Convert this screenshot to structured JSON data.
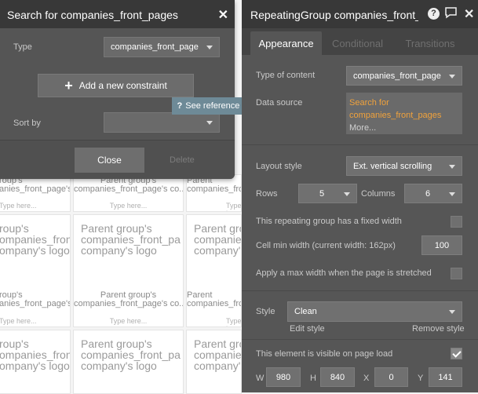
{
  "background": {
    "name_text": "Parent group's\ncompanies_front_page's co...",
    "logo_text": "Parent group's\ncompanies_front_pa\ncompany's logo",
    "type_here": "Type here...",
    "partial_logo": "roup's\nompanies_front_pa\nompany's logo",
    "partial_name_left": "roup's\nanies_front_page's co...",
    "partial_name_right": "Parent\ncompanies_front"
  },
  "left_panel": {
    "title": "Search for companies_front_pages",
    "close_icon": "close-icon",
    "type_label": "Type",
    "type_value": "companies_front_page",
    "add_constraint_label": "Add a new constraint",
    "sort_by_label": "Sort by",
    "sort_by_value": "",
    "close_button": "Close",
    "delete_button": "Delete"
  },
  "see_reference": {
    "label": "See reference →",
    "icon": "question-icon"
  },
  "right_panel": {
    "title": "RepeatingGroup companies_front_pa",
    "icons": [
      "help-icon",
      "comment-icon",
      "close-icon"
    ],
    "tabs": [
      "Appearance",
      "Conditional",
      "Transitions"
    ],
    "active_tab": "Appearance",
    "type_of_content_label": "Type of content",
    "type_of_content_value": "companies_front_page",
    "data_source_label": "Data source",
    "data_source_line1": "Search for",
    "data_source_line2": "companies_front_pages",
    "data_source_more": "More...",
    "layout_style_label": "Layout style",
    "layout_style_value": "Ext. vertical scrolling",
    "rows_label": "Rows",
    "rows_value": "5",
    "columns_label": "Columns",
    "columns_value": "6",
    "fixed_width_label": "This repeating group has a fixed width",
    "fixed_width_checked": false,
    "cell_min_width_label": "Cell min width (current width: 162px)",
    "cell_min_width_value": "100",
    "max_width_label": "Apply a max width when the page is stretched",
    "max_width_checked": false,
    "style_label": "Style",
    "style_value": "Clean",
    "edit_style": "Edit style",
    "remove_style": "Remove style",
    "visible_label": "This element is visible on page load",
    "visible_checked": true,
    "w_label": "W",
    "w_value": "980",
    "h_label": "H",
    "h_value": "840",
    "x_label": "X",
    "x_value": "0",
    "y_label": "Y",
    "y_value": "141"
  },
  "colors": {
    "panel_bg": "#565656",
    "header_bg": "#383838",
    "accent_orange": "#f0a23c",
    "reference_pill": "#6e8a97"
  }
}
